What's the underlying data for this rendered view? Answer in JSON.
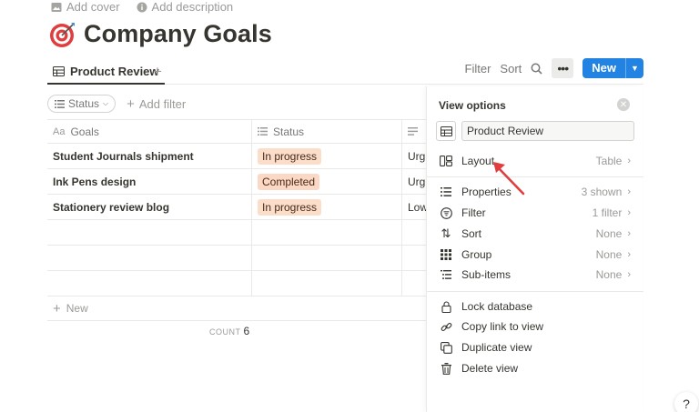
{
  "page": {
    "add_cover": "Add cover",
    "add_description": "Add description",
    "title": "Company Goals"
  },
  "tabs": [
    {
      "label": "Product Review"
    }
  ],
  "toolbar": {
    "filter": "Filter",
    "sort": "Sort",
    "new_label": "New"
  },
  "filterbar": {
    "status_chip": "Status",
    "add_filter": "Add filter"
  },
  "table": {
    "headers": {
      "goals": "Goals",
      "status": "Status"
    },
    "rows": [
      {
        "goal": "Student Journals shipment",
        "status": "In progress",
        "priority": "Urg"
      },
      {
        "goal": "Ink Pens design",
        "status": "Completed",
        "priority": "Urg"
      },
      {
        "goal": "Stationery review blog",
        "status": "In progress",
        "priority": "Low"
      }
    ],
    "new_row": "New",
    "count_label": "COUNT",
    "count_value": "6"
  },
  "view_options": {
    "title": "View options",
    "view_name": "Product Review",
    "items": [
      {
        "label": "Layout",
        "value": "Table"
      },
      {
        "label": "Properties",
        "value": "3 shown"
      },
      {
        "label": "Filter",
        "value": "1 filter"
      },
      {
        "label": "Sort",
        "value": "None"
      },
      {
        "label": "Group",
        "value": "None"
      },
      {
        "label": "Sub-items",
        "value": "None"
      }
    ],
    "actions": [
      {
        "label": "Lock database"
      },
      {
        "label": "Copy link to view"
      },
      {
        "label": "Duplicate view"
      },
      {
        "label": "Delete view"
      }
    ]
  },
  "colors": {
    "accent": "#2383e2",
    "tag_orange": "#fadec9",
    "arrow": "#e03e3e"
  },
  "help": "?"
}
